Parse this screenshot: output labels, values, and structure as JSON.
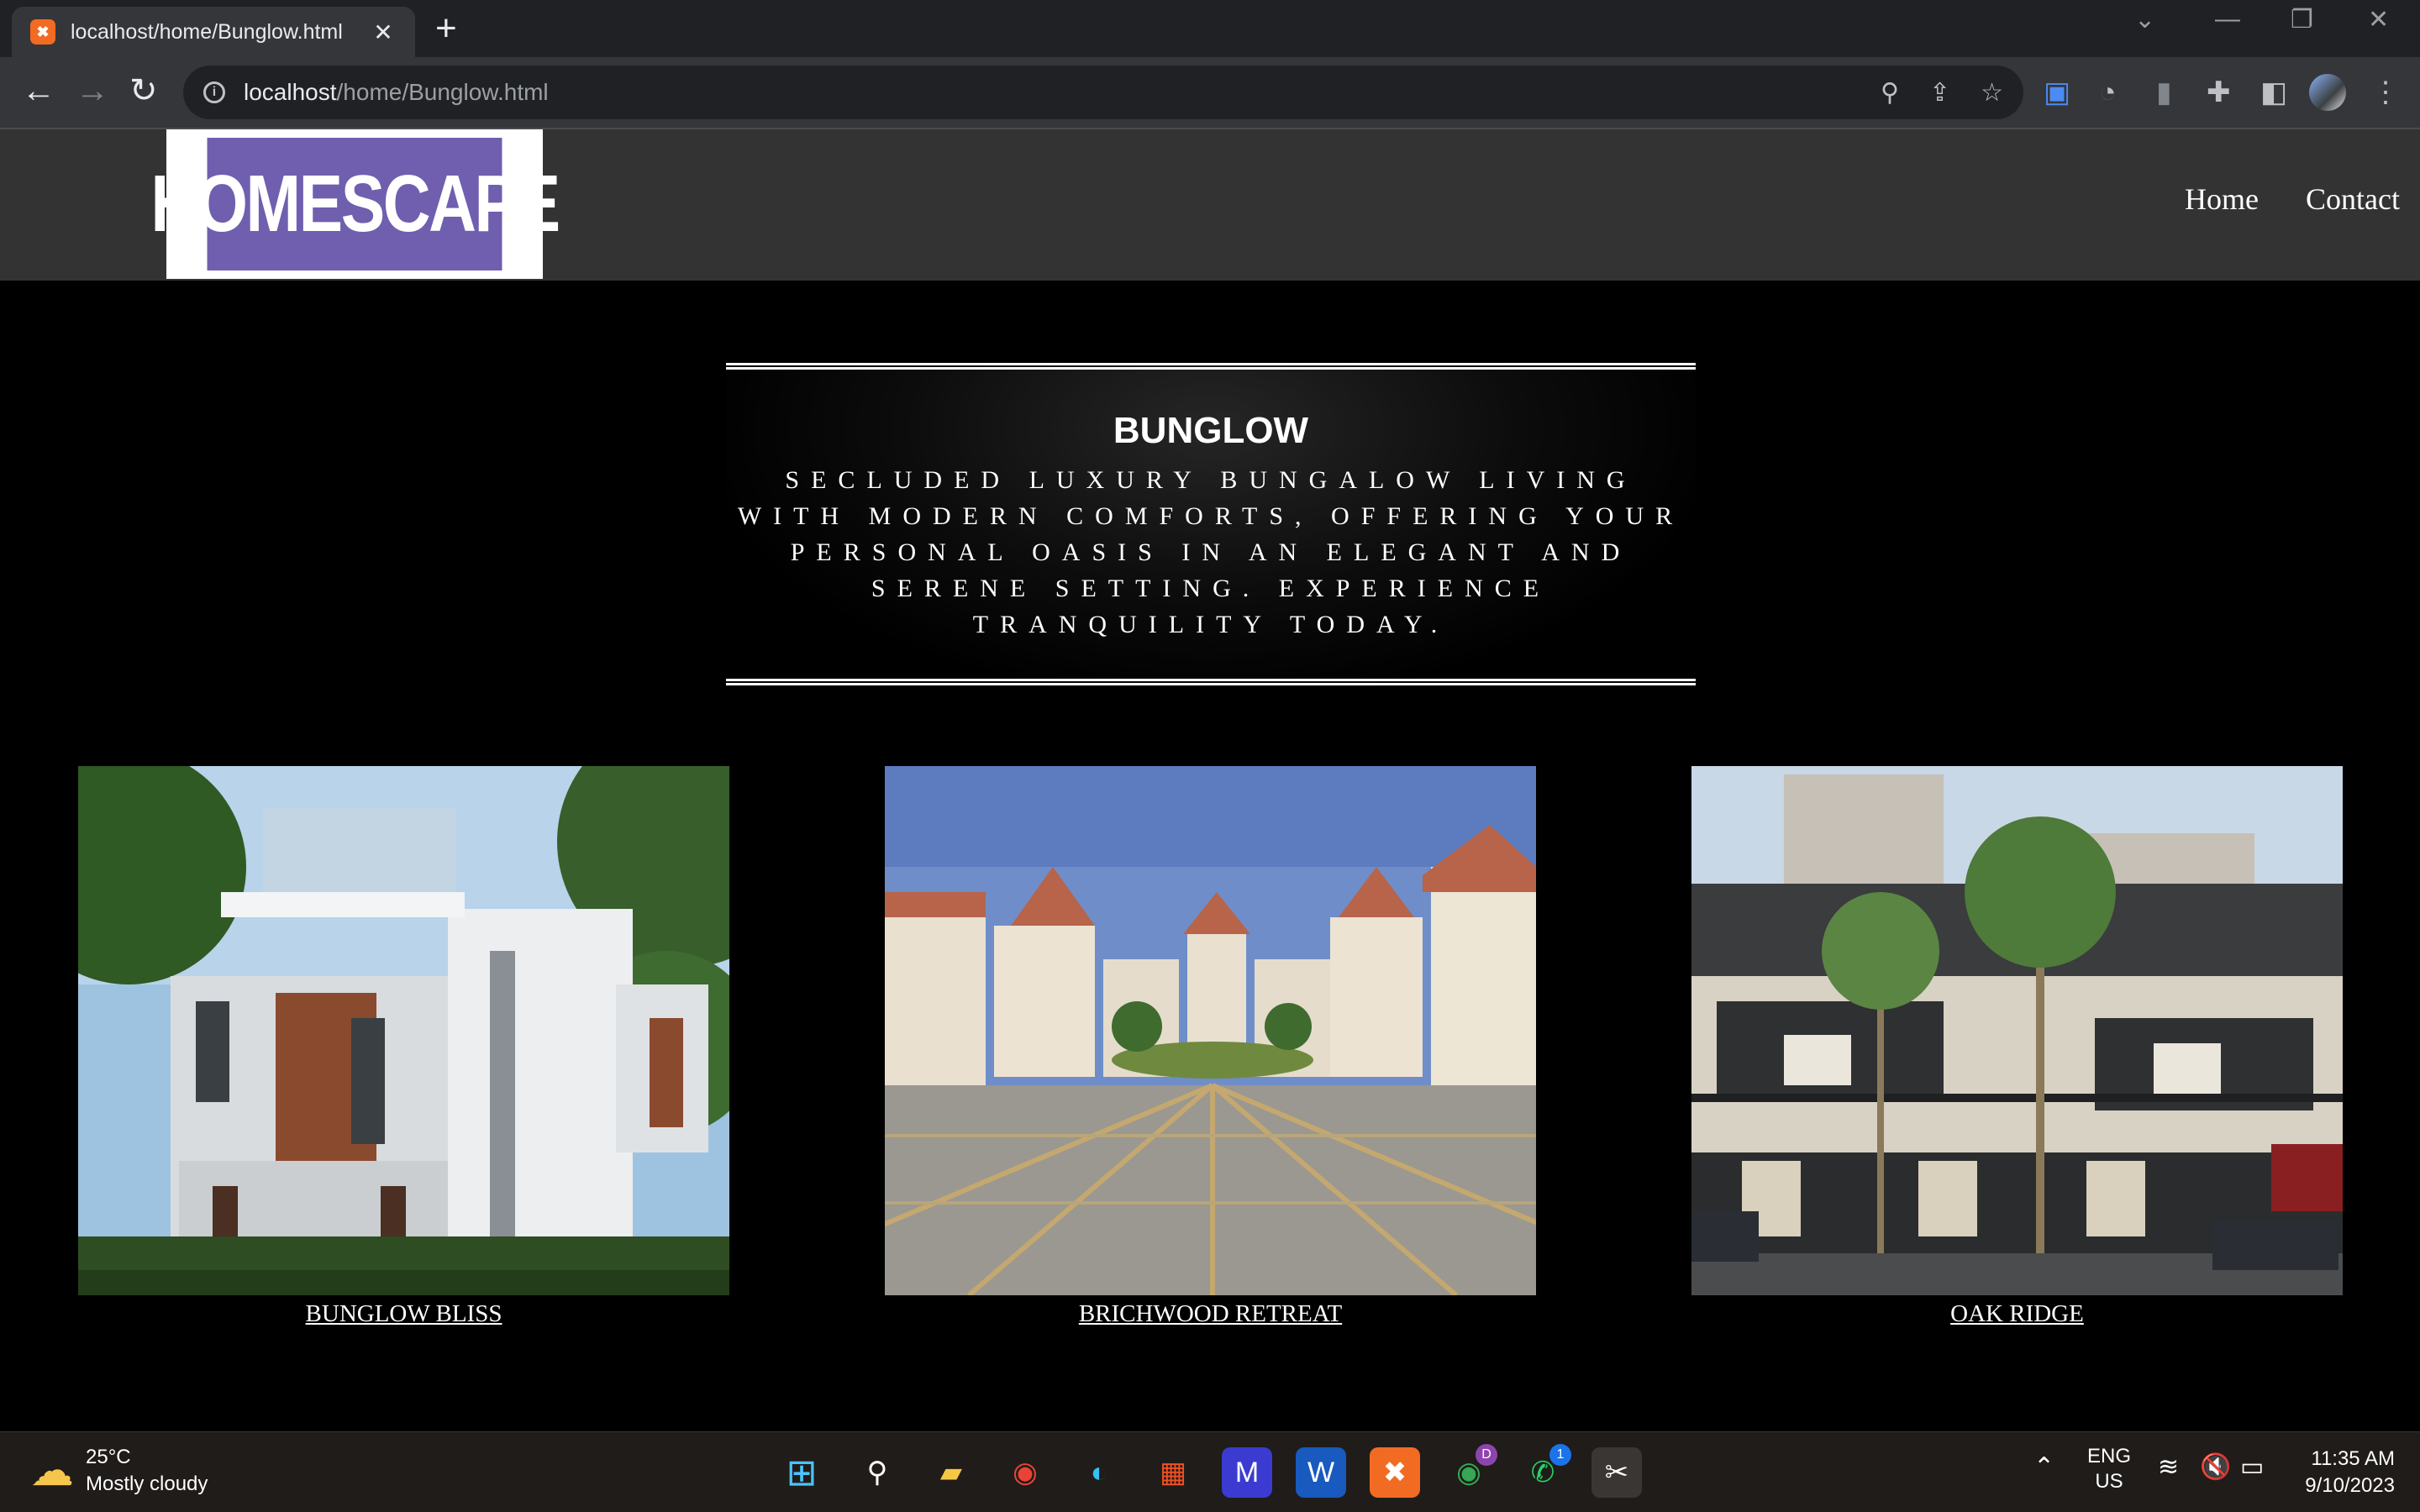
{
  "browser": {
    "tab_title": "localhost/home/Bunglow.html",
    "tab_favicon": "xampp-icon",
    "url_host": "localhost",
    "url_path": "/home/Bunglow.html"
  },
  "site": {
    "logo_text": "HOMESCAPE",
    "nav": {
      "home": "Home",
      "contact": "Contact"
    }
  },
  "hero": {
    "title": "BUNGLOW",
    "text": "SECLUDED LUXURY BUNGALOW LIVING WITH MODERN COMFORTS, OFFERING YOUR PERSONAL OASIS IN AN ELEGANT AND SERENE SETTING. EXPERIENCE TRANQUILITY TODAY."
  },
  "cards": [
    {
      "label": "BUNGLOW BLISS"
    },
    {
      "label": "BRICHWOOD RETREAT"
    },
    {
      "label": "OAK RIDGE"
    }
  ],
  "taskbar": {
    "temperature": "25°C",
    "weather": "Mostly cloudy",
    "lang_top": "ENG",
    "lang_bottom": "US",
    "time": "11:35 AM",
    "date": "9/10/2023",
    "badge_whatsapp": "1",
    "badge_chrome_profile": "D"
  },
  "colors": {
    "logo_purple": "#6f5fae",
    "header_bg": "#333333",
    "page_bg": "#000000"
  }
}
